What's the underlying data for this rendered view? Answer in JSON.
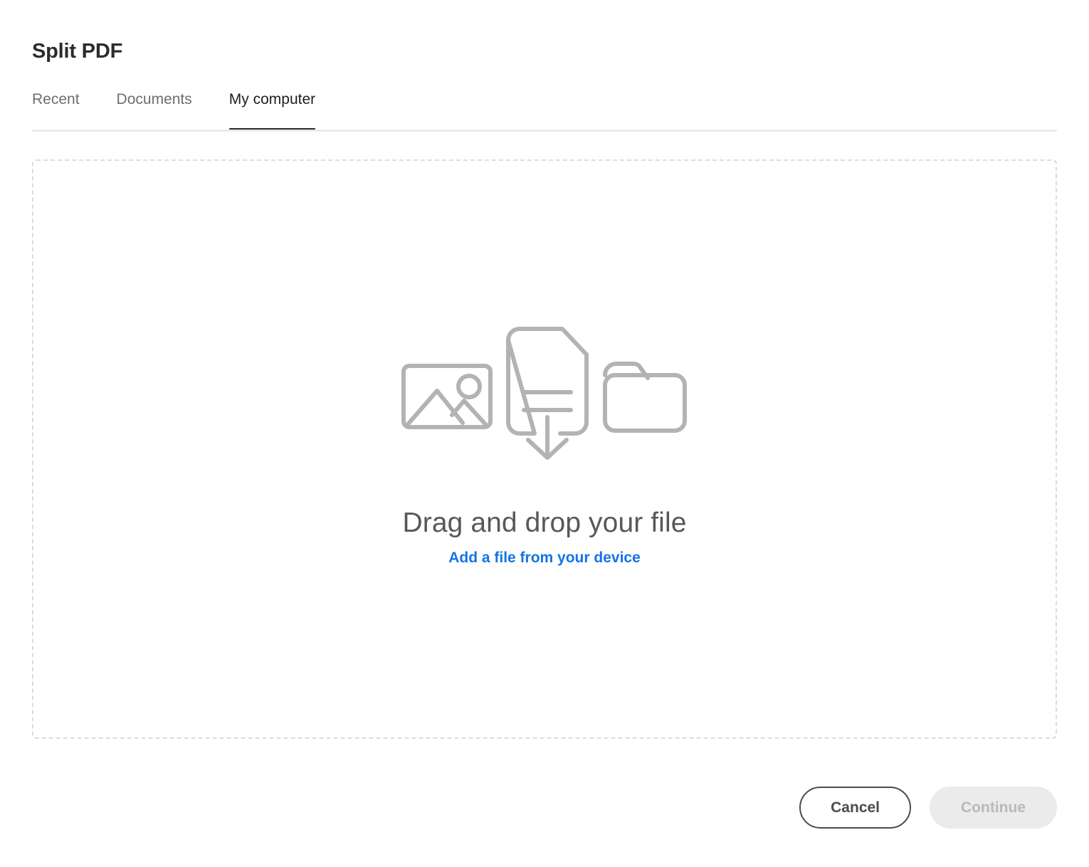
{
  "header": {
    "title": "Split PDF"
  },
  "tabs": [
    {
      "label": "Recent",
      "active": false
    },
    {
      "label": "Documents",
      "active": false
    },
    {
      "label": "My computer",
      "active": true
    }
  ],
  "dropzone": {
    "heading": "Drag and drop your file",
    "link_label": "Add a file from your device",
    "icons": [
      "image-icon",
      "document-download-icon",
      "folder-icon"
    ]
  },
  "footer": {
    "cancel_label": "Cancel",
    "continue_label": "Continue",
    "continue_disabled": true
  },
  "colors": {
    "accent_link": "#1473e6",
    "title_text": "#2c2c2c",
    "tab_inactive": "#6e6e6e",
    "tab_active_underline": "#2c2c2c",
    "dashed_border": "#dcdcdc",
    "icon_gray": "#b3b3b3",
    "heading_gray": "#585858",
    "cancel_border": "#4b4b4b",
    "continue_bg": "#ebebeb",
    "continue_text": "#b9b9b9"
  }
}
